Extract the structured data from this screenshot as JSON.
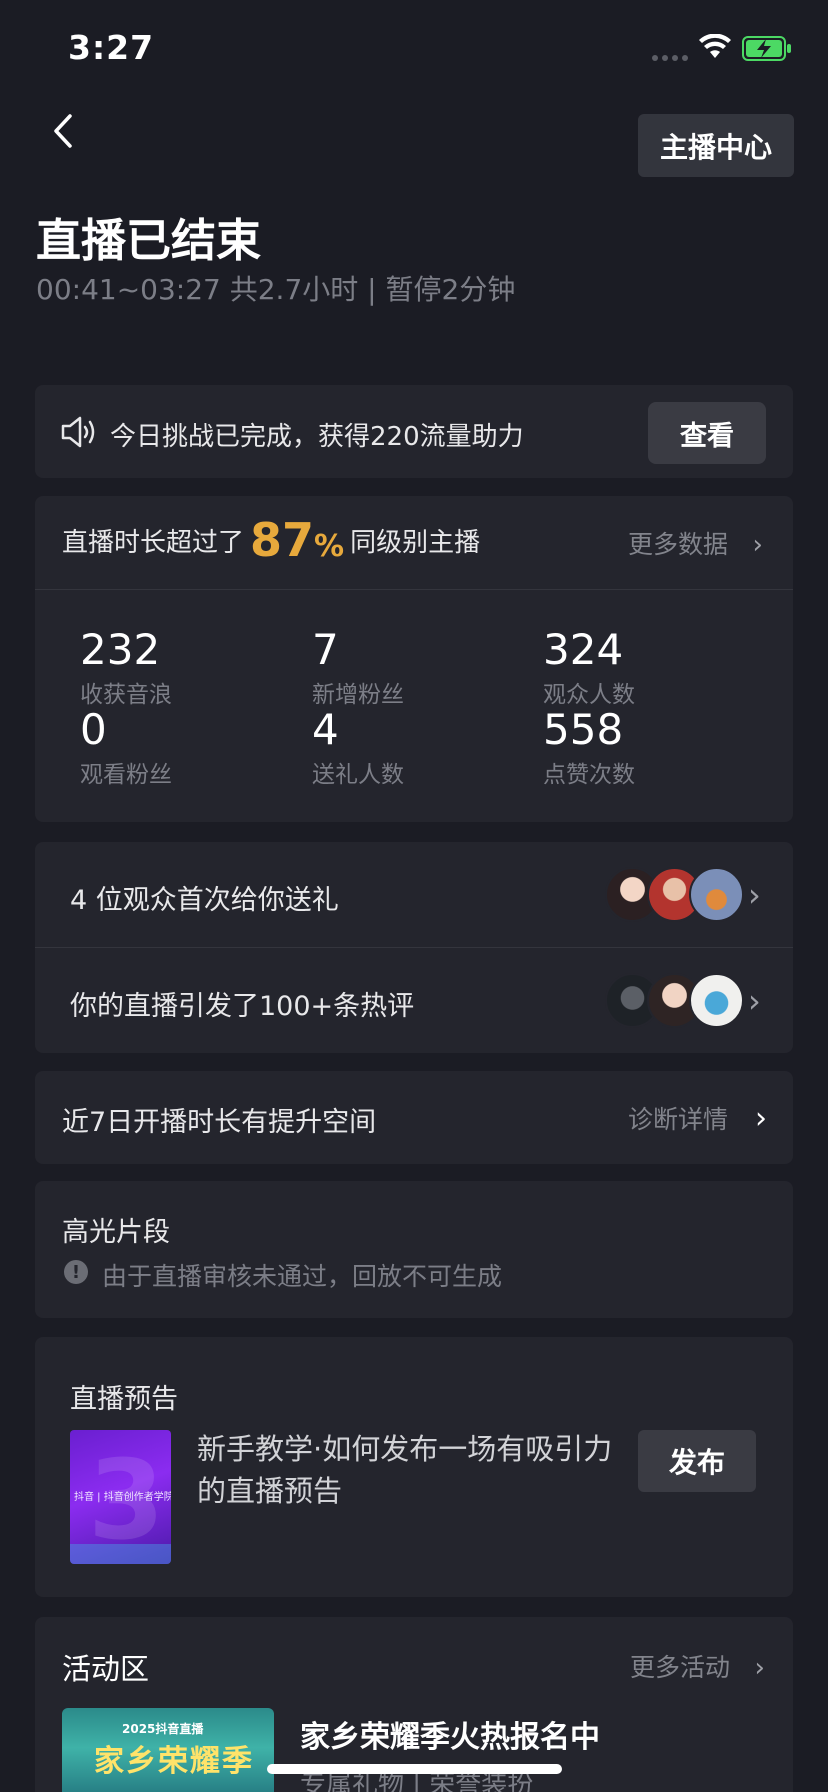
{
  "status_bar": {
    "time": "3:27"
  },
  "header": {
    "anchor_center_label": "主播中心",
    "title": "直播已结束",
    "subtitle": "00:41~03:27 共2.7小时 | 暂停2分钟"
  },
  "notice": {
    "text": "今日挑战已完成，获得220流量助力",
    "button_label": "查看"
  },
  "stats": {
    "prefix": "直播时长超过了",
    "percent": "87",
    "percent_unit": "%",
    "suffix": "同级别主播",
    "more_label": "更多数据",
    "items": [
      {
        "value": "232",
        "label": "收获音浪"
      },
      {
        "value": "7",
        "label": "新增粉丝"
      },
      {
        "value": "324",
        "label": "观众人数"
      },
      {
        "value": "0",
        "label": "观看粉丝"
      },
      {
        "value": "4",
        "label": "送礼人数"
      },
      {
        "value": "558",
        "label": "点赞次数"
      }
    ]
  },
  "gift_row": {
    "text": "4 位观众首次给你送礼"
  },
  "comment_row": {
    "text": "你的直播引发了100+条热评"
  },
  "diagnosis": {
    "text": "近7日开播时长有提升空间",
    "link_label": "诊断详情"
  },
  "highlight": {
    "title": "高光片段",
    "warning": "由于直播审核未通过，回放不可生成"
  },
  "preview": {
    "title": "直播预告",
    "thumb_caption": "抖音 | 抖音创作者学院",
    "text": "新手教学·如何发布一场有吸引力的直播预告",
    "button_label": "发布"
  },
  "activity": {
    "title": "活动区",
    "more_label": "更多活动",
    "image_year": "2025抖音直播",
    "image_name": "家乡荣耀季",
    "item_title": "家乡荣耀季火热报名中",
    "item_subtitle": "专属礼物 | 荣誉装扮"
  },
  "colors": {
    "background": "#1b1c24",
    "card": "#24252d",
    "accent_percent": "#e7a93c",
    "battery": "#4cd964"
  }
}
